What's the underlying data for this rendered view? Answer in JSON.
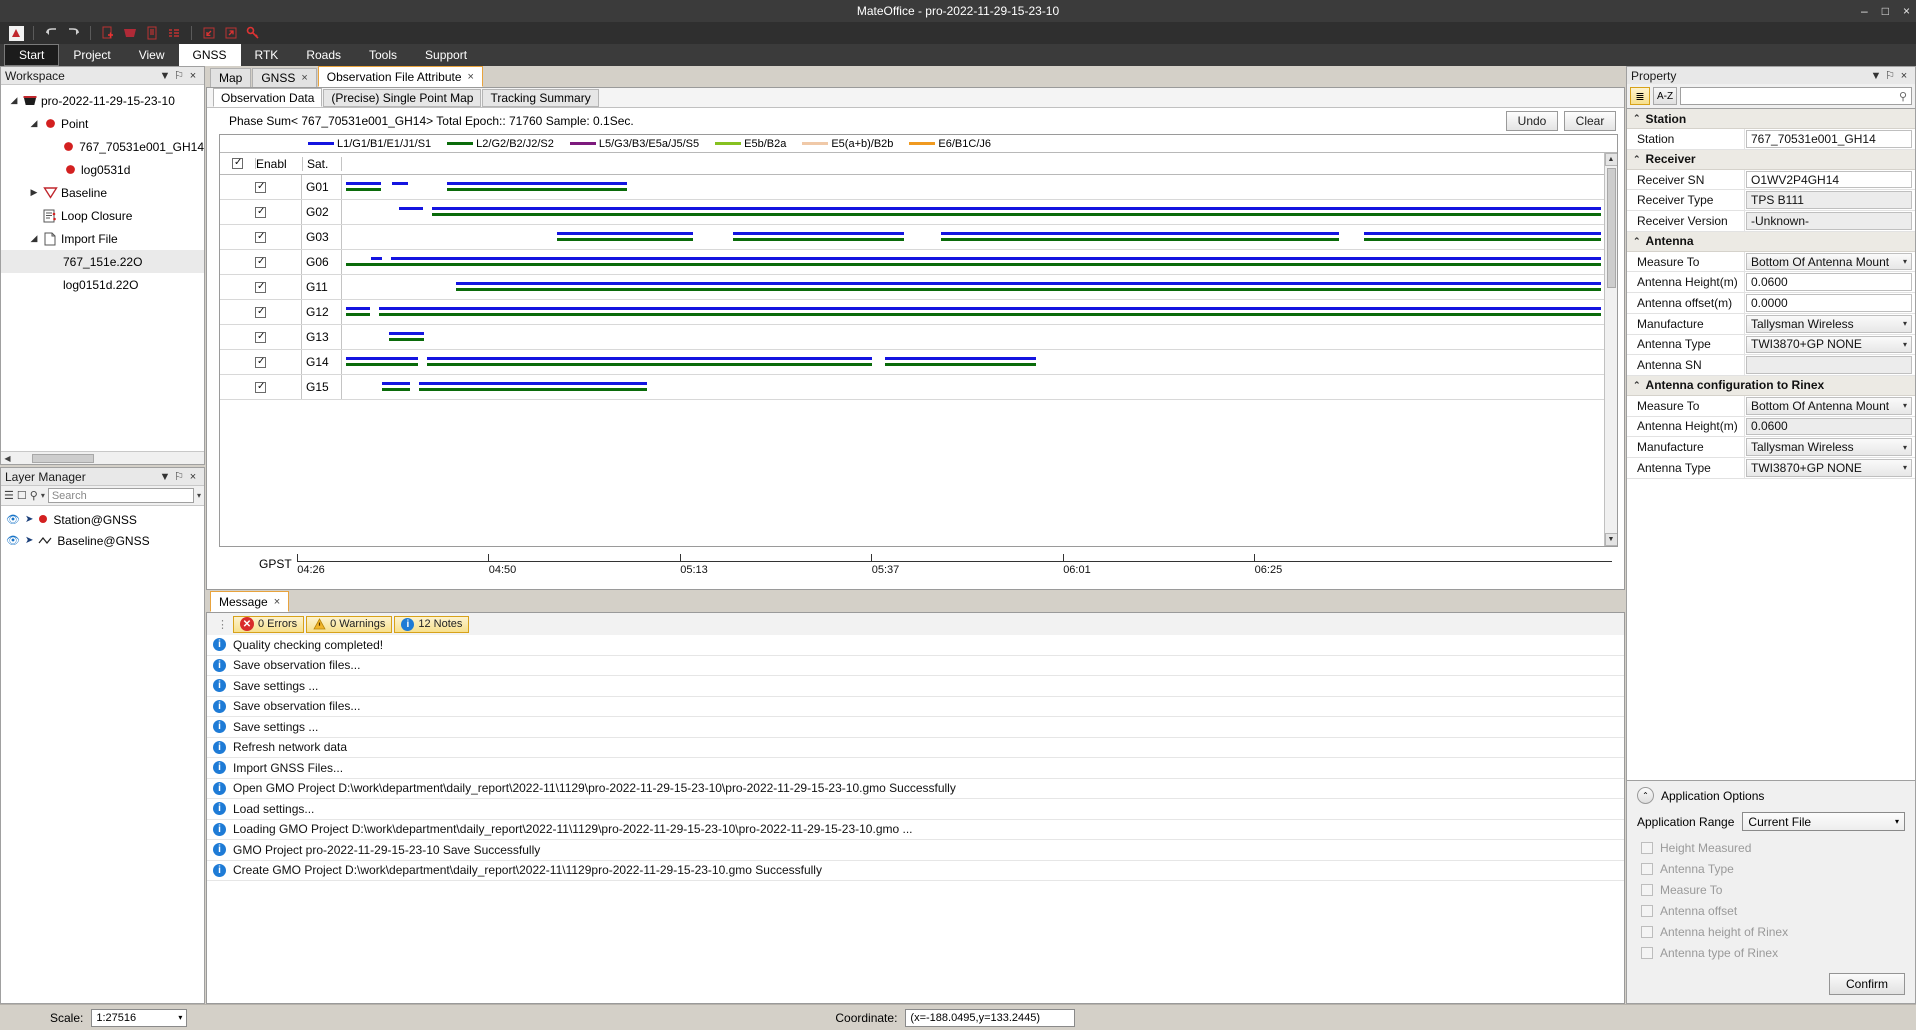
{
  "window": {
    "title": "MateOffice - pro-2022-11-29-15-23-10",
    "minimize": "–",
    "maximize": "□",
    "close": "×"
  },
  "quick_toolbar": {
    "icons": [
      {
        "name": "app-logo-icon",
        "glyph": "✶"
      },
      {
        "name": "undo-icon",
        "glyph": "↶"
      },
      {
        "name": "redo-icon",
        "glyph": "↷"
      },
      {
        "name": "new-file-icon",
        "glyph": "➕"
      },
      {
        "name": "open-folder-icon",
        "glyph": "▼"
      },
      {
        "name": "save-icon",
        "glyph": "▤"
      },
      {
        "name": "list-icon",
        "glyph": "≡"
      },
      {
        "name": "import-icon",
        "glyph": "↙"
      },
      {
        "name": "export-icon",
        "glyph": "↗"
      },
      {
        "name": "key-icon",
        "glyph": "⚿"
      }
    ]
  },
  "ribbon": {
    "tabs": [
      {
        "label": "Start",
        "state": "start"
      },
      {
        "label": "Project",
        "state": "normal"
      },
      {
        "label": "View",
        "state": "normal"
      },
      {
        "label": "GNSS",
        "state": "active"
      },
      {
        "label": "RTK",
        "state": "normal"
      },
      {
        "label": "Roads",
        "state": "normal"
      },
      {
        "label": "Tools",
        "state": "normal"
      },
      {
        "label": "Support",
        "state": "normal"
      }
    ]
  },
  "workspace": {
    "title": "Workspace",
    "dropdown": "▼",
    "pin": "⚐",
    "close": "×",
    "tree": [
      {
        "label": "pro-2022-11-29-15-23-10",
        "indent": 0,
        "twisty": "◢",
        "icon": "project-folder-icon",
        "selected": false
      },
      {
        "label": "Point",
        "indent": 1,
        "twisty": "◢",
        "icon": "point-icon",
        "selected": false
      },
      {
        "label": "767_70531e001_GH14",
        "indent": 2,
        "twisty": "",
        "icon": "point-icon",
        "selected": false
      },
      {
        "label": "log0531d",
        "indent": 2,
        "twisty": "",
        "icon": "point-icon",
        "selected": false
      },
      {
        "label": "Baseline",
        "indent": 1,
        "twisty": "▶",
        "icon": "baseline-icon",
        "selected": false
      },
      {
        "label": "Loop Closure",
        "indent": 1,
        "twisty": "",
        "icon": "loop-closure-icon",
        "selected": false
      },
      {
        "label": "Import File",
        "indent": 1,
        "twisty": "◢",
        "icon": "import-file-icon",
        "selected": false
      },
      {
        "label": "767_151e.22O",
        "indent": 2,
        "twisty": "",
        "icon": "",
        "selected": true
      },
      {
        "label": "log0151d.22O",
        "indent": 2,
        "twisty": "",
        "icon": "",
        "selected": false
      }
    ]
  },
  "layer_manager": {
    "title": "Layer Manager",
    "dropdown": "▼",
    "pin": "⚐",
    "close": "×",
    "search_placeholder": "Search",
    "toolbar_icons": [
      {
        "name": "layer-list-icon",
        "glyph": "☰"
      },
      {
        "name": "new-layer-icon",
        "glyph": "□"
      },
      {
        "name": "zoom-layer-icon",
        "glyph": "⚲"
      },
      {
        "name": "layer-dropdown-icon",
        "glyph": "▾"
      }
    ],
    "layers": [
      {
        "label": "Station@GNSS",
        "eye": "◉",
        "cursor": "➤"
      },
      {
        "label": "Baseline@GNSS",
        "eye": "◉",
        "cursor": "➤"
      }
    ]
  },
  "doc_tabs": [
    {
      "label": "Map",
      "active": false,
      "closable": false
    },
    {
      "label": "GNSS",
      "active": false,
      "closable": true
    },
    {
      "label": "Observation File Attribute",
      "active": true,
      "closable": true
    }
  ],
  "sub_tabs": [
    {
      "label": "Observation Data",
      "active": true
    },
    {
      "label": "(Precise) Single Point Map",
      "active": false
    },
    {
      "label": "Tracking Summary",
      "active": false
    }
  ],
  "chart_header": {
    "summary": "Phase Sum< 767_70531e001_GH14>  Total Epoch:: 71760  Sample: 0.1Sec.",
    "undo_label": "Undo",
    "clear_label": "Clear"
  },
  "chart_data": {
    "type": "timeline",
    "title": "Phase Sum< 767_70531e001_GH14>",
    "total_epoch": 71760,
    "sample": "0.1Sec.",
    "xlabel": "GPST",
    "x_ticks": [
      "04:26",
      "04:50",
      "05:13",
      "05:37",
      "06:01",
      "06:25"
    ],
    "x_tick_positions_pct": [
      0.0,
      19.5,
      39.0,
      58.5,
      78.0,
      97.5
    ],
    "columns": [
      "Enabl",
      "Sat."
    ],
    "legend": [
      {
        "label": "L1/G1/B1/E1/J1/S1",
        "color": "#1414e0"
      },
      {
        "label": "L2/G2/B2/J2/S2",
        "color": "#0a6b0a"
      },
      {
        "label": "L5/G3/B3/E5a/J5/S5",
        "color": "#7d1a7d"
      },
      {
        "label": "E5b/B2a",
        "color": "#86c120"
      },
      {
        "label": "E5(a+b)/B2b",
        "color": "#f0c9a8"
      },
      {
        "label": "E6/B1C/J6",
        "color": "#f09a20"
      }
    ],
    "satellites": [
      {
        "sat": "G01",
        "enabled": true,
        "segments": [
          {
            "band": 0,
            "start": 0.3,
            "end": 3.1
          },
          {
            "band": 0,
            "start": 4.0,
            "end": 5.2
          },
          {
            "band": 0,
            "start": 8.3,
            "end": 22.6
          },
          {
            "band": 1,
            "start": 0.3,
            "end": 3.1
          },
          {
            "band": 1,
            "start": 8.3,
            "end": 22.6
          }
        ]
      },
      {
        "sat": "G02",
        "enabled": true,
        "segments": [
          {
            "band": 0,
            "start": 4.5,
            "end": 6.4
          },
          {
            "band": 0,
            "start": 7.1,
            "end": 99.8
          },
          {
            "band": 1,
            "start": 7.1,
            "end": 99.8
          }
        ]
      },
      {
        "sat": "G03",
        "enabled": true,
        "segments": [
          {
            "band": 0,
            "start": 17.0,
            "end": 27.8
          },
          {
            "band": 0,
            "start": 31.0,
            "end": 44.5
          },
          {
            "band": 0,
            "start": 47.5,
            "end": 79.0
          },
          {
            "band": 0,
            "start": 81.0,
            "end": 99.8
          },
          {
            "band": 1,
            "start": 17.0,
            "end": 27.8
          },
          {
            "band": 1,
            "start": 31.0,
            "end": 44.5
          },
          {
            "band": 1,
            "start": 47.5,
            "end": 79.0
          },
          {
            "band": 1,
            "start": 81.0,
            "end": 99.8
          }
        ]
      },
      {
        "sat": "G06",
        "enabled": true,
        "segments": [
          {
            "band": 0,
            "start": 2.3,
            "end": 3.2
          },
          {
            "band": 0,
            "start": 3.9,
            "end": 99.8
          },
          {
            "band": 1,
            "start": 0.3,
            "end": 99.8
          }
        ]
      },
      {
        "sat": "G11",
        "enabled": true,
        "segments": [
          {
            "band": 0,
            "start": 9.0,
            "end": 99.8
          },
          {
            "band": 1,
            "start": 9.0,
            "end": 99.8
          }
        ]
      },
      {
        "sat": "G12",
        "enabled": true,
        "segments": [
          {
            "band": 0,
            "start": 0.3,
            "end": 2.2
          },
          {
            "band": 0,
            "start": 2.9,
            "end": 99.8
          },
          {
            "band": 1,
            "start": 0.3,
            "end": 2.2
          },
          {
            "band": 1,
            "start": 2.9,
            "end": 99.8
          }
        ]
      },
      {
        "sat": "G13",
        "enabled": true,
        "segments": [
          {
            "band": 0,
            "start": 3.7,
            "end": 6.5
          },
          {
            "band": 1,
            "start": 3.7,
            "end": 6.5
          }
        ]
      },
      {
        "sat": "G14",
        "enabled": true,
        "segments": [
          {
            "band": 0,
            "start": 0.3,
            "end": 6.0
          },
          {
            "band": 0,
            "start": 6.7,
            "end": 42.0
          },
          {
            "band": 0,
            "start": 43.0,
            "end": 55.0
          },
          {
            "band": 1,
            "start": 0.3,
            "end": 6.0
          },
          {
            "band": 1,
            "start": 6.7,
            "end": 42.0
          },
          {
            "band": 1,
            "start": 43.0,
            "end": 55.0
          }
        ]
      },
      {
        "sat": "G15",
        "enabled": true,
        "segments": [
          {
            "band": 0,
            "start": 3.2,
            "end": 5.4
          },
          {
            "band": 0,
            "start": 6.1,
            "end": 24.2
          },
          {
            "band": 1,
            "start": 3.2,
            "end": 5.4
          },
          {
            "band": 1,
            "start": 6.1,
            "end": 24.2
          }
        ]
      }
    ]
  },
  "message_panel": {
    "tab_label": "Message",
    "tab_close": "×",
    "filters": [
      {
        "label": "0 Errors",
        "icon": "error-icon"
      },
      {
        "label": "0 Warnings",
        "icon": "warning-icon"
      },
      {
        "label": "12 Notes",
        "icon": "info-icon"
      }
    ],
    "rows": [
      "Quality checking completed!",
      "Save observation files...",
      "Save settings ...",
      "Save observation files...",
      "Save settings ...",
      "Refresh network data",
      "Import GNSS Files...",
      "Open GMO Project D:\\work\\department\\daily_report\\2022-11\\1129\\pro-2022-11-29-15-23-10\\pro-2022-11-29-15-23-10.gmo Successfully",
      "Load settings...",
      "Loading GMO Project D:\\work\\department\\daily_report\\2022-11\\1129\\pro-2022-11-29-15-23-10\\pro-2022-11-29-15-23-10.gmo ...",
      "GMO Project pro-2022-11-29-15-23-10 Save Successfully",
      "Create GMO Project D:\\work\\department\\daily_report\\2022-11\\1129pro-2022-11-29-15-23-10.gmo Successfully"
    ]
  },
  "property": {
    "title": "Property",
    "dropdown": "▼",
    "pin": "⚐",
    "close": "×",
    "categorize_icon": "≣",
    "sort_label": "A-Z",
    "search_value": "",
    "search_icon": "⚲",
    "groups": [
      {
        "name": "Station",
        "caret": "⌃",
        "rows": [
          {
            "label": "Station",
            "value": "767_70531e001_GH14",
            "style": "edit"
          }
        ]
      },
      {
        "name": "Receiver",
        "caret": "⌃",
        "rows": [
          {
            "label": "Receiver SN",
            "value": "O1WV2P4GH14",
            "style": "edit"
          },
          {
            "label": "Receiver Type",
            "value": "TPS B111",
            "style": "readonly"
          },
          {
            "label": "Receiver Version",
            "value": "-Unknown-",
            "style": "readonly"
          }
        ]
      },
      {
        "name": "Antenna",
        "caret": "⌃",
        "rows": [
          {
            "label": "Measure To",
            "value": "Bottom Of Antenna Mount",
            "style": "dropdown"
          },
          {
            "label": "Antenna Height(m)",
            "value": "0.0600",
            "style": "edit"
          },
          {
            "label": "Antenna offset(m)",
            "value": "0.0000",
            "style": "edit"
          },
          {
            "label": "Manufacture",
            "value": "Tallysman Wireless",
            "style": "dropdown"
          },
          {
            "label": "Antenna Type",
            "value": "TWI3870+GP     NONE",
            "style": "dropdown"
          },
          {
            "label": "Antenna SN",
            "value": "",
            "style": "readonly"
          }
        ]
      },
      {
        "name": "Antenna configuration to Rinex",
        "caret": "⌃",
        "rows": [
          {
            "label": "Measure To",
            "value": "Bottom Of Antenna Mount",
            "style": "dropdown"
          },
          {
            "label": "Antenna Height(m)",
            "value": "0.0600",
            "style": "readonly"
          },
          {
            "label": "Manufacture",
            "value": "Tallysman Wireless",
            "style": "dropdown"
          },
          {
            "label": "Antenna Type",
            "value": "TWI3870+GP     NONE",
            "style": "dropdown"
          }
        ]
      }
    ]
  },
  "application_options": {
    "title": "Application Options",
    "collapse_icon": "⌃",
    "range_label": "Application Range",
    "range_value": "Current File",
    "caret": "▾",
    "checkboxes": [
      {
        "label": "Height Measured",
        "checked": false
      },
      {
        "label": "Antenna Type",
        "checked": false
      },
      {
        "label": "Measure To",
        "checked": false
      },
      {
        "label": "Antenna offset",
        "checked": false
      },
      {
        "label": "Antenna height of Rinex",
        "checked": false
      },
      {
        "label": "Antenna type of Rinex",
        "checked": false
      }
    ],
    "confirm_label": "Confirm"
  },
  "status_bar": {
    "scale_label": "Scale:",
    "scale_value": "1:27516",
    "caret": "▾",
    "coordinate_label": "Coordinate:",
    "coordinate_value": "(x=-188.0495,y=133.2445)"
  }
}
